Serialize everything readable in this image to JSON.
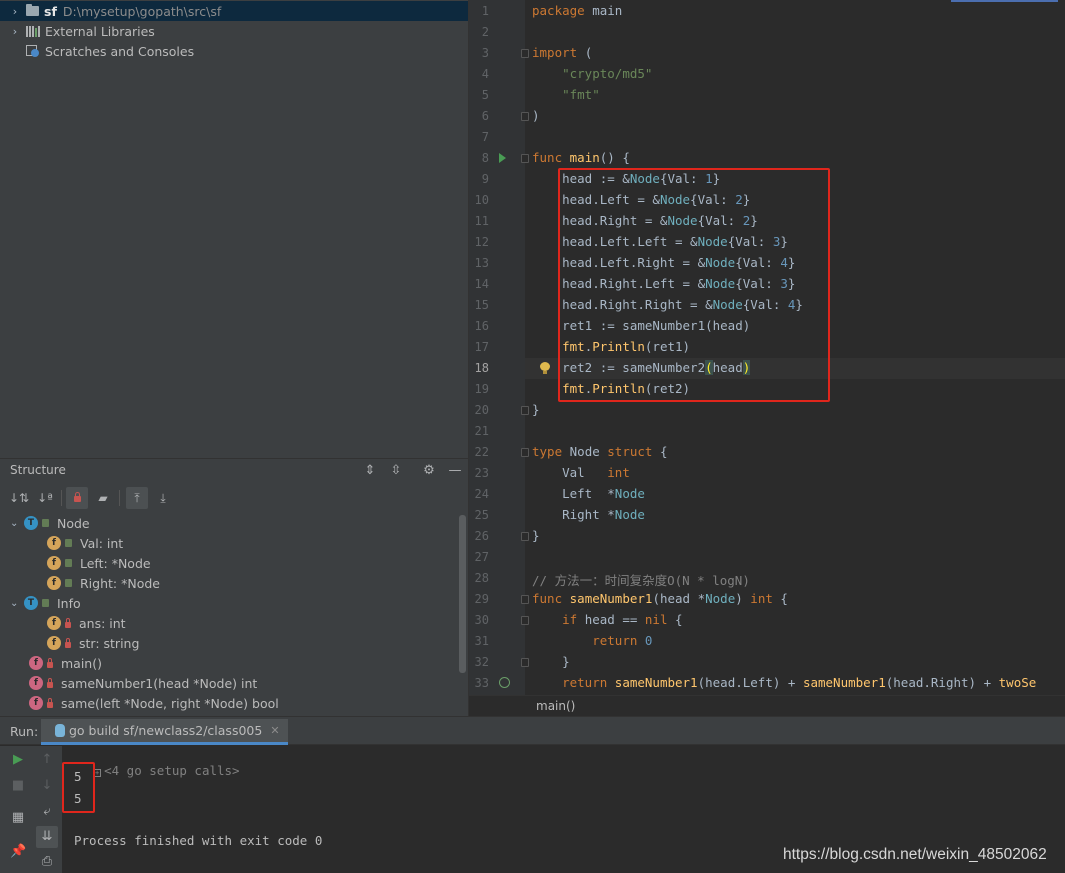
{
  "project": {
    "items": [
      {
        "name": "sf",
        "path": "D:\\mysetup\\gopath\\src\\sf",
        "icon": "folder-icon",
        "expanded": false
      },
      {
        "label": "External Libraries",
        "icon": "library-icon",
        "expanded": false
      },
      {
        "label": "Scratches and Consoles",
        "icon": "scratches-icon"
      }
    ]
  },
  "structure": {
    "title": "Structure",
    "header_icons": [
      "expand-all-icon",
      "collapse-all-icon",
      "settings-icon",
      "minimize-icon"
    ],
    "toolbar_icons": [
      "sort-by-visibility-icon",
      "sort-alphabetically-icon",
      "show-private-icon",
      "show-fields-icon",
      "autoscroll-to-source-icon",
      "autoscroll-from-source-icon"
    ],
    "items": [
      {
        "label": "Node",
        "badge": "T",
        "level": 0,
        "expanded": true
      },
      {
        "label": "Val: int",
        "badge": "f",
        "level": 1
      },
      {
        "label": "Left: *Node",
        "badge": "f",
        "level": 1
      },
      {
        "label": "Right: *Node",
        "badge": "f",
        "level": 1
      },
      {
        "label": "Info",
        "badge": "T",
        "level": 0,
        "expanded": true
      },
      {
        "label": "ans: int",
        "badge": "f",
        "level": 1
      },
      {
        "label": "str: string",
        "badge": "f",
        "level": 1
      },
      {
        "label": "main()",
        "badge": "f",
        "level": 0
      },
      {
        "label": "sameNumber1(head *Node) int",
        "badge": "f",
        "level": 0
      },
      {
        "label": "same(left *Node, right *Node) bool",
        "badge": "f",
        "level": 0
      }
    ]
  },
  "editor": {
    "current_line": 18,
    "breadcrumb": "main()",
    "lines": [
      [
        [
          "kw",
          "package "
        ],
        [
          "t",
          "main"
        ]
      ],
      [],
      [
        [
          "kw",
          "import "
        ],
        [
          "t",
          "("
        ]
      ],
      [
        [
          "t",
          "    "
        ],
        [
          "str",
          "\"crypto/md5\""
        ]
      ],
      [
        [
          "t",
          "    "
        ],
        [
          "str",
          "\"fmt\""
        ]
      ],
      [
        [
          "t",
          ")"
        ]
      ],
      [],
      [
        [
          "kw",
          "func "
        ],
        [
          "fn",
          "main"
        ],
        [
          "t",
          "() {"
        ]
      ],
      [
        [
          "t",
          "    head := &"
        ],
        [
          "ty",
          "Node"
        ],
        [
          "t",
          "{Val: "
        ],
        [
          "num",
          "1"
        ],
        [
          "t",
          "}"
        ]
      ],
      [
        [
          "t",
          "    head.Left = &"
        ],
        [
          "ty",
          "Node"
        ],
        [
          "t",
          "{Val: "
        ],
        [
          "num",
          "2"
        ],
        [
          "t",
          "}"
        ]
      ],
      [
        [
          "t",
          "    head.Right = &"
        ],
        [
          "ty",
          "Node"
        ],
        [
          "t",
          "{Val: "
        ],
        [
          "num",
          "2"
        ],
        [
          "t",
          "}"
        ]
      ],
      [
        [
          "t",
          "    head.Left.Left = &"
        ],
        [
          "ty",
          "Node"
        ],
        [
          "t",
          "{Val: "
        ],
        [
          "num",
          "3"
        ],
        [
          "t",
          "}"
        ]
      ],
      [
        [
          "t",
          "    head.Left.Right = &"
        ],
        [
          "ty",
          "Node"
        ],
        [
          "t",
          "{Val: "
        ],
        [
          "num",
          "4"
        ],
        [
          "t",
          "}"
        ]
      ],
      [
        [
          "t",
          "    head.Right.Left = &"
        ],
        [
          "ty",
          "Node"
        ],
        [
          "t",
          "{Val: "
        ],
        [
          "num",
          "3"
        ],
        [
          "t",
          "}"
        ]
      ],
      [
        [
          "t",
          "    head.Right.Right = &"
        ],
        [
          "ty",
          "Node"
        ],
        [
          "t",
          "{Val: "
        ],
        [
          "num",
          "4"
        ],
        [
          "t",
          "}"
        ]
      ],
      [
        [
          "t",
          "    ret1 := sameNumber1(head)"
        ]
      ],
      [
        [
          "t",
          "    "
        ],
        [
          "fn",
          "fmt"
        ],
        [
          "t",
          "."
        ],
        [
          "fn",
          "Println"
        ],
        [
          "t",
          "(ret1)"
        ]
      ],
      [
        [
          "t",
          "    ret2 := sameNumber2"
        ],
        [
          "bm",
          "("
        ],
        [
          "t",
          "head"
        ],
        [
          "bm",
          ")"
        ]
      ],
      [
        [
          "t",
          "    "
        ],
        [
          "fn",
          "fmt"
        ],
        [
          "t",
          "."
        ],
        [
          "fn",
          "Println"
        ],
        [
          "t",
          "(ret2)"
        ]
      ],
      [
        [
          "t",
          "}"
        ]
      ],
      [],
      [
        [
          "kw",
          "type "
        ],
        [
          "t",
          "Node "
        ],
        [
          "kw",
          "struct "
        ],
        [
          "t",
          "{"
        ]
      ],
      [
        [
          "t",
          "    Val   "
        ],
        [
          "kw",
          "int"
        ]
      ],
      [
        [
          "t",
          "    Left  *"
        ],
        [
          "ty",
          "Node"
        ]
      ],
      [
        [
          "t",
          "    Right *"
        ],
        [
          "ty",
          "Node"
        ]
      ],
      [
        [
          "t",
          "}"
        ]
      ],
      [],
      [
        [
          "cm",
          "// 方法一：时间复杂度O(N * logN)"
        ]
      ],
      [
        [
          "kw",
          "func "
        ],
        [
          "fn",
          "sameNumber1"
        ],
        [
          "t",
          "(head *"
        ],
        [
          "ty",
          "Node"
        ],
        [
          "t",
          ") "
        ],
        [
          "kw",
          "int "
        ],
        [
          "t",
          "{"
        ]
      ],
      [
        [
          "t",
          "    "
        ],
        [
          "kw",
          "if "
        ],
        [
          "t",
          "head == "
        ],
        [
          "kw",
          "nil "
        ],
        [
          "t",
          "{"
        ]
      ],
      [
        [
          "t",
          "        "
        ],
        [
          "kw",
          "return "
        ],
        [
          "num",
          "0"
        ]
      ],
      [
        [
          "t",
          "    }"
        ]
      ],
      [
        [
          "t",
          "    "
        ],
        [
          "kw",
          "return "
        ],
        [
          "fn",
          "sameNumber1"
        ],
        [
          "t",
          "(head.Left) + "
        ],
        [
          "fn",
          "sameNumber1"
        ],
        [
          "t",
          "(head.Right) + "
        ],
        [
          "fn",
          "twoSe"
        ]
      ]
    ]
  },
  "run": {
    "label": "Run:",
    "tab_label": "go build sf/newclass2/class005",
    "setup_calls": "<4 go setup calls>",
    "output": [
      "5",
      "5"
    ],
    "exit_message": "Process finished with exit code 0",
    "sidebar_icons": [
      "rerun-icon",
      "up-icon",
      "stop-icon",
      "down-icon",
      "soft-wrap-icon",
      "layout-icon",
      "scroll-to-end-icon",
      "pin-icon",
      "print-icon"
    ]
  },
  "watermark": "https://blog.csdn.net/weixin_48502062",
  "colors": {
    "highlight_box": "#e0261c",
    "keyword": "#cc7832",
    "string": "#6a8759",
    "number": "#6897bb",
    "type": "#6fafbd",
    "function": "#ffc66d"
  }
}
